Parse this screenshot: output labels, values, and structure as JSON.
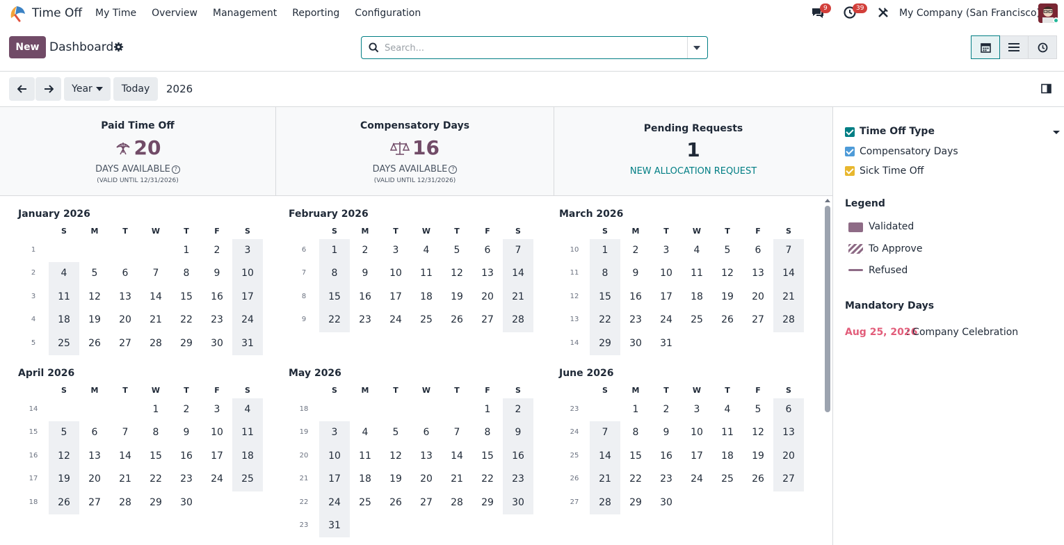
{
  "navbar": {
    "app_name": "Time Off",
    "menu": [
      "My Time",
      "Overview",
      "Management",
      "Reporting",
      "Configuration"
    ],
    "messages_badge": "9",
    "activities_badge": "39",
    "company": "My Company (San Francisco)",
    "icons": [
      "chat-icon",
      "clock-icon",
      "tools-icon"
    ]
  },
  "control": {
    "new_label": "New",
    "title": "Dashboard",
    "search_placeholder": "Search...",
    "views": [
      "calendar-view",
      "list-view",
      "activity-view"
    ]
  },
  "toolbar": {
    "scale_label": "Year",
    "today_label": "Today",
    "current_year": "2026"
  },
  "summary": {
    "cards": [
      {
        "title": "Paid Time Off",
        "value": "20",
        "available": "DAYS AVAILABLE",
        "valid": "(VALID UNTIL 12/31/2026)"
      },
      {
        "title": "Compensatory Days",
        "value": "16",
        "available": "DAYS AVAILABLE",
        "valid": "(VALID UNTIL 12/31/2026)"
      }
    ],
    "pending": {
      "title": "Pending Requests",
      "value": "1",
      "link": "NEW ALLOCATION REQUEST"
    }
  },
  "calendar": {
    "dow": [
      "S",
      "M",
      "T",
      "W",
      "T",
      "F",
      "S"
    ],
    "months": [
      {
        "name": "January 2026",
        "start": 4,
        "days": 31,
        "first_week": 1
      },
      {
        "name": "February 2026",
        "start": 0,
        "days": 28,
        "first_week": 6
      },
      {
        "name": "March 2026",
        "start": 0,
        "days": 31,
        "first_week": 10
      },
      {
        "name": "April 2026",
        "start": 3,
        "days": 30,
        "first_week": 14
      },
      {
        "name": "May 2026",
        "start": 5,
        "days": 31,
        "first_week": 18
      },
      {
        "name": "June 2026",
        "start": 1,
        "days": 30,
        "first_week": 23
      }
    ]
  },
  "sidebar": {
    "filter_title": "Time Off Type",
    "filters": [
      {
        "label": "Compensatory Days",
        "color": "#4e9bd8"
      },
      {
        "label": "Sick Time Off",
        "color": "#e8b72e"
      }
    ],
    "legend_title": "Legend",
    "legend": [
      "Validated",
      "To Approve",
      "Refused"
    ],
    "mandatory_title": "Mandatory Days",
    "mandatory_date": "Aug 25, 2026",
    "mandatory_name": ": Company Celebration"
  },
  "colors": {
    "brand": "#714b67",
    "accent": "#017e84",
    "weekend": "#eef0f3",
    "mandatory": "#e25d7a"
  }
}
